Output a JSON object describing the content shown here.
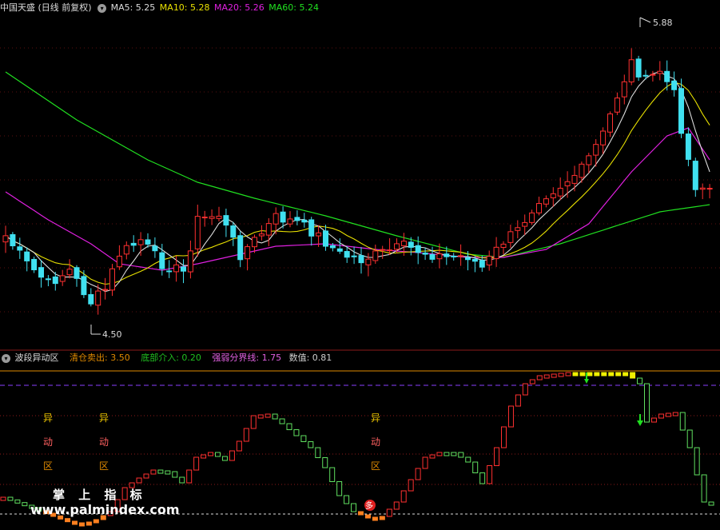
{
  "main": {
    "title": "中国天盛 (日线 前复权)",
    "ma": [
      {
        "label": "MA5: 5.25",
        "color": "#dcdcdc"
      },
      {
        "label": "MA10: 5.28",
        "color": "#e8e000"
      },
      {
        "label": "MA20: 5.26",
        "color": "#e020e0"
      },
      {
        "label": "MA60: 5.24",
        "color": "#20e020"
      }
    ],
    "high_label": "5.88",
    "low_label": "4.50"
  },
  "indicator": {
    "title": "波段异动区",
    "params": [
      {
        "label": "清仓卖出: 3.50",
        "color": "#e08a00"
      },
      {
        "label": "底部介入: 0.20",
        "color": "#20c020"
      },
      {
        "label": "强弱分界线: 1.75",
        "color": "#e060e0"
      },
      {
        "label": "数值: 0.81",
        "color": "#cfcfcf"
      }
    ],
    "zone_chars": [
      "异",
      "动",
      "区"
    ],
    "zone_colors": [
      "#e8c000",
      "#ff6060",
      "#e08a00"
    ],
    "badge": "多"
  },
  "watermark": {
    "line1": "掌 上 指 标",
    "line2": "www.palmindex.com"
  },
  "colors": {
    "up": "#ff3030",
    "down": "#40e0f0",
    "ma5": "#dcdcdc",
    "ma10": "#e8e000",
    "ma20": "#e020e0",
    "ma60": "#20e020"
  }
}
